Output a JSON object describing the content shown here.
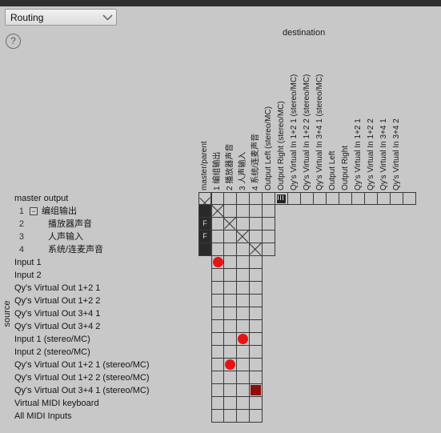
{
  "window": {
    "titlebar_color": "#2e2e2e",
    "background_color": "#c8c8c8"
  },
  "toolbar": {
    "mode_select": {
      "value": "Routing",
      "options": [
        "Routing"
      ],
      "chevron_icon": "chevron-down-icon"
    },
    "help_button": {
      "label": "?",
      "icon": "question-mark-icon"
    }
  },
  "matrix": {
    "destination_caption": "destination",
    "source_caption": "source",
    "accent_red": "#e81414",
    "accent_red_dark": "#8e0d0d",
    "columns": [
      {
        "label": "master/parent",
        "kind": "master"
      },
      {
        "label": "1  编组输出",
        "kind": "cjk"
      },
      {
        "label": "2  播放器声音",
        "kind": "cjk"
      },
      {
        "label": "3  人声输入",
        "kind": "cjk"
      },
      {
        "label": "4  系统/连麦声音",
        "kind": "cjk"
      },
      {
        "label": "Output Left (stereo/MC)",
        "kind": "out"
      },
      {
        "label": "Output Right (stereo/MC)",
        "kind": "out"
      },
      {
        "label": "Qy's Virtual In 1+2 1 (stereo/MC)",
        "kind": "out"
      },
      {
        "label": "Qy's Virtual In 1+2 2 (stereo/MC)",
        "kind": "out"
      },
      {
        "label": "Qy's Virtual In 3+4 1 (stereo/MC)",
        "kind": "out"
      },
      {
        "label": "Output Left",
        "kind": "out"
      },
      {
        "label": "Output Right",
        "kind": "out"
      },
      {
        "label": "Qy's Virtual In 1+2 1",
        "kind": "out"
      },
      {
        "label": "Qy's Virtual In 1+2 2",
        "kind": "out"
      },
      {
        "label": "Qy's Virtual In 3+4 1",
        "kind": "out"
      },
      {
        "label": "Qy's Virtual In 3+4 2",
        "kind": "out"
      }
    ],
    "rows": [
      {
        "label": "master output",
        "num": "",
        "level": 0,
        "expander": "",
        "state": "x",
        "cells": 16
      },
      {
        "label": "编组输出",
        "num": "1",
        "level": 1,
        "expander": "−",
        "state": "dark",
        "cells": 5
      },
      {
        "label": "播放器声音",
        "num": "2",
        "level": 2,
        "expander": "",
        "state": "f",
        "cells": 5
      },
      {
        "label": "人声输入",
        "num": "3",
        "level": 2,
        "expander": "",
        "state": "f",
        "cells": 5
      },
      {
        "label": "系统/连麦声音",
        "num": "4",
        "level": 2,
        "expander": "",
        "state": "dark",
        "cells": 5
      },
      {
        "label": "Input 1",
        "num": "",
        "level": 0,
        "expander": "",
        "state": "none",
        "cells": 4
      },
      {
        "label": "Input 2",
        "num": "",
        "level": 0,
        "expander": "",
        "state": "none",
        "cells": 4
      },
      {
        "label": "Qy's Virtual Out 1+2 1",
        "num": "",
        "level": 0,
        "expander": "",
        "state": "none",
        "cells": 4
      },
      {
        "label": "Qy's Virtual Out 1+2 2",
        "num": "",
        "level": 0,
        "expander": "",
        "state": "none",
        "cells": 4
      },
      {
        "label": "Qy's Virtual Out 3+4 1",
        "num": "",
        "level": 0,
        "expander": "",
        "state": "none",
        "cells": 4
      },
      {
        "label": "Qy's Virtual Out 3+4 2",
        "num": "",
        "level": 0,
        "expander": "",
        "state": "none",
        "cells": 4
      },
      {
        "label": "Input 1 (stereo/MC)",
        "num": "",
        "level": 0,
        "expander": "",
        "state": "none",
        "cells": 4
      },
      {
        "label": "Input 2 (stereo/MC)",
        "num": "",
        "level": 0,
        "expander": "",
        "state": "none",
        "cells": 4
      },
      {
        "label": "Qy's Virtual Out 1+2 1 (stereo/MC)",
        "num": "",
        "level": 0,
        "expander": "",
        "state": "none",
        "cells": 4
      },
      {
        "label": "Qy's Virtual Out 1+2 2 (stereo/MC)",
        "num": "",
        "level": 0,
        "expander": "",
        "state": "none",
        "cells": 4
      },
      {
        "label": "Qy's Virtual Out 3+4 1 (stereo/MC)",
        "num": "",
        "level": 0,
        "expander": "",
        "state": "none",
        "cells": 4
      },
      {
        "label": "Virtual MIDI keyboard",
        "num": "",
        "level": 0,
        "expander": "",
        "state": "none",
        "cells": 4
      },
      {
        "label": "All MIDI Inputs",
        "num": "",
        "level": 0,
        "expander": "",
        "state": "none",
        "cells": 4
      }
    ],
    "connections": [
      {
        "row": 0,
        "col": 5,
        "type": "midi-keyboard-icon"
      },
      {
        "row": 1,
        "col": 7,
        "type": "midi-keyboard-icon"
      },
      {
        "row": 1,
        "col": 9,
        "type": "midi-keyboard-icon"
      },
      {
        "row": 5,
        "col": 0,
        "type": "dot"
      },
      {
        "row": 11,
        "col": 2,
        "type": "dot"
      },
      {
        "row": 13,
        "col": 1,
        "type": "dot"
      },
      {
        "row": 15,
        "col": 3,
        "type": "dot-dark"
      }
    ],
    "diagonals": [
      {
        "row": 1,
        "col": 0
      },
      {
        "row": 2,
        "col": 1
      },
      {
        "row": 3,
        "col": 2
      },
      {
        "row": 4,
        "col": 3
      }
    ]
  }
}
